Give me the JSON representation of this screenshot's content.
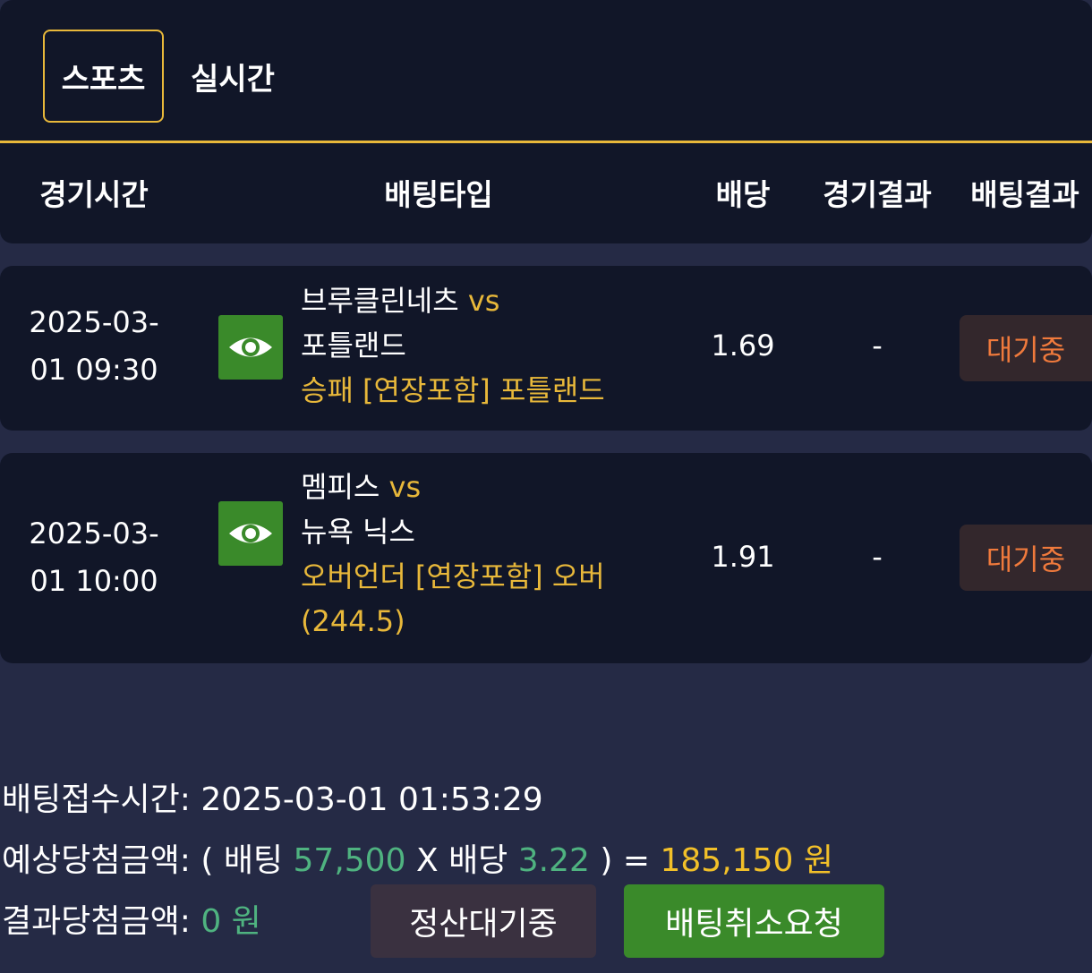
{
  "tabs": {
    "sports": "스포츠",
    "live": "실시간"
  },
  "columns": {
    "time": "경기시간",
    "type": "배팅타입",
    "odds": "배당",
    "game_result": "경기결과",
    "bet_result": "배팅결과"
  },
  "bets": [
    {
      "time_line1": "2025-03-",
      "time_line2": "01 09:30",
      "home": "브루클린네츠",
      "vs": "vs",
      "away": "포틀랜드",
      "pick": "승패 [연장포함] 포틀랜드",
      "odds": "1.69",
      "game_result": "-",
      "status": "대기중"
    },
    {
      "time_line1": "2025-03-",
      "time_line2": "01 10:00",
      "home": "멤피스",
      "vs": "vs",
      "away": "뉴욕 닉스",
      "pick_line1": "오버언더 [연장포함] 오버",
      "pick_line2": "(244.5)",
      "odds": "1.91",
      "game_result": "-",
      "status": "대기중"
    }
  ],
  "summary": {
    "bet_time_label": "배팅접수시간:",
    "bet_time": "2025-03-01 01:53:29",
    "expected_label": "예상당첨금액:",
    "open_paren": "(",
    "bet_label": "배팅",
    "bet_amount": "57,500",
    "times": "X",
    "odds_label": "배당",
    "total_odds": "3.22",
    "close_paren": ")",
    "equals": "=",
    "expected_amount": "185,150 원",
    "result_label": "결과당첨금액:",
    "result_amount": "0 원"
  },
  "buttons": {
    "pending": "정산대기중",
    "cancel_request": "배팅취소요청"
  },
  "colors": {
    "background": "#252a45",
    "card": "#111628",
    "accent_gold": "#e8b83a",
    "eye_button": "#3a8a2a",
    "status_orange": "#f07a3c",
    "amount_green": "#4fb380"
  },
  "icons": {
    "view": "eye-icon"
  }
}
